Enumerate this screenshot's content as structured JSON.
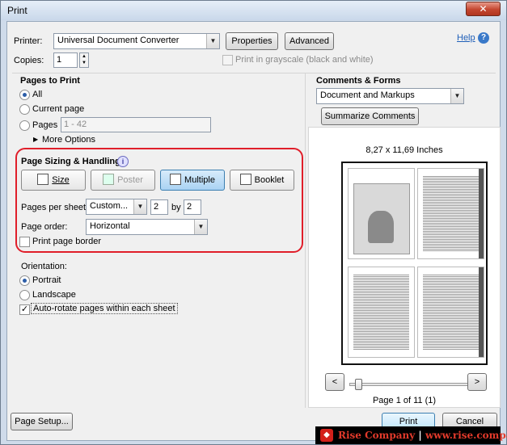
{
  "window": {
    "title": "Print",
    "close_label": "✕"
  },
  "top": {
    "printer_label": "Printer:",
    "printer_value": "Universal Document Converter",
    "properties_label": "Properties",
    "advanced_label": "Advanced",
    "help_label": "Help",
    "help_icon": "?",
    "copies_label": "Copies:",
    "copies_value": "1",
    "grayscale_label": "Print in grayscale (black and white)"
  },
  "pages_to_print": {
    "title": "Pages to Print",
    "all_label": "All",
    "current_page_label": "Current page",
    "pages_label": "Pages",
    "pages_value": "1 - 42",
    "more_options_label": "More Options"
  },
  "sizing": {
    "title": "Page Sizing & Handling",
    "info_icon": "i",
    "size_label": "Size",
    "poster_label": "Poster",
    "multiple_label": "Multiple",
    "booklet_label": "Booklet",
    "pages_per_sheet_label": "Pages per sheet:",
    "pages_per_sheet_value": "Custom...",
    "cols_value": "2",
    "by_label": "by",
    "rows_value": "2",
    "page_order_label": "Page order:",
    "page_order_value": "Horizontal",
    "print_border_label": "Print page border",
    "highlight_color": "#e01e2a"
  },
  "orientation": {
    "title": "Orientation:",
    "portrait_label": "Portrait",
    "landscape_label": "Landscape",
    "autorotate_label": "Auto-rotate pages within each sheet",
    "autorotate_checked": "✓"
  },
  "comments_forms": {
    "title": "Comments & Forms",
    "value": "Document and Markups",
    "summarize_label": "Summarize Comments"
  },
  "preview": {
    "size_text": "8,27 x 11,69 Inches",
    "prev_label": "<",
    "next_label": ">",
    "page_info": "Page 1 of 11 (1)"
  },
  "bottom": {
    "page_setup_label": "Page Setup...",
    "print_label": "Print",
    "cancel_label": "Cancel"
  },
  "watermark": {
    "logo": "◆",
    "brand": "Rise Company",
    "separator": " | ",
    "url": "www.rise.company"
  }
}
